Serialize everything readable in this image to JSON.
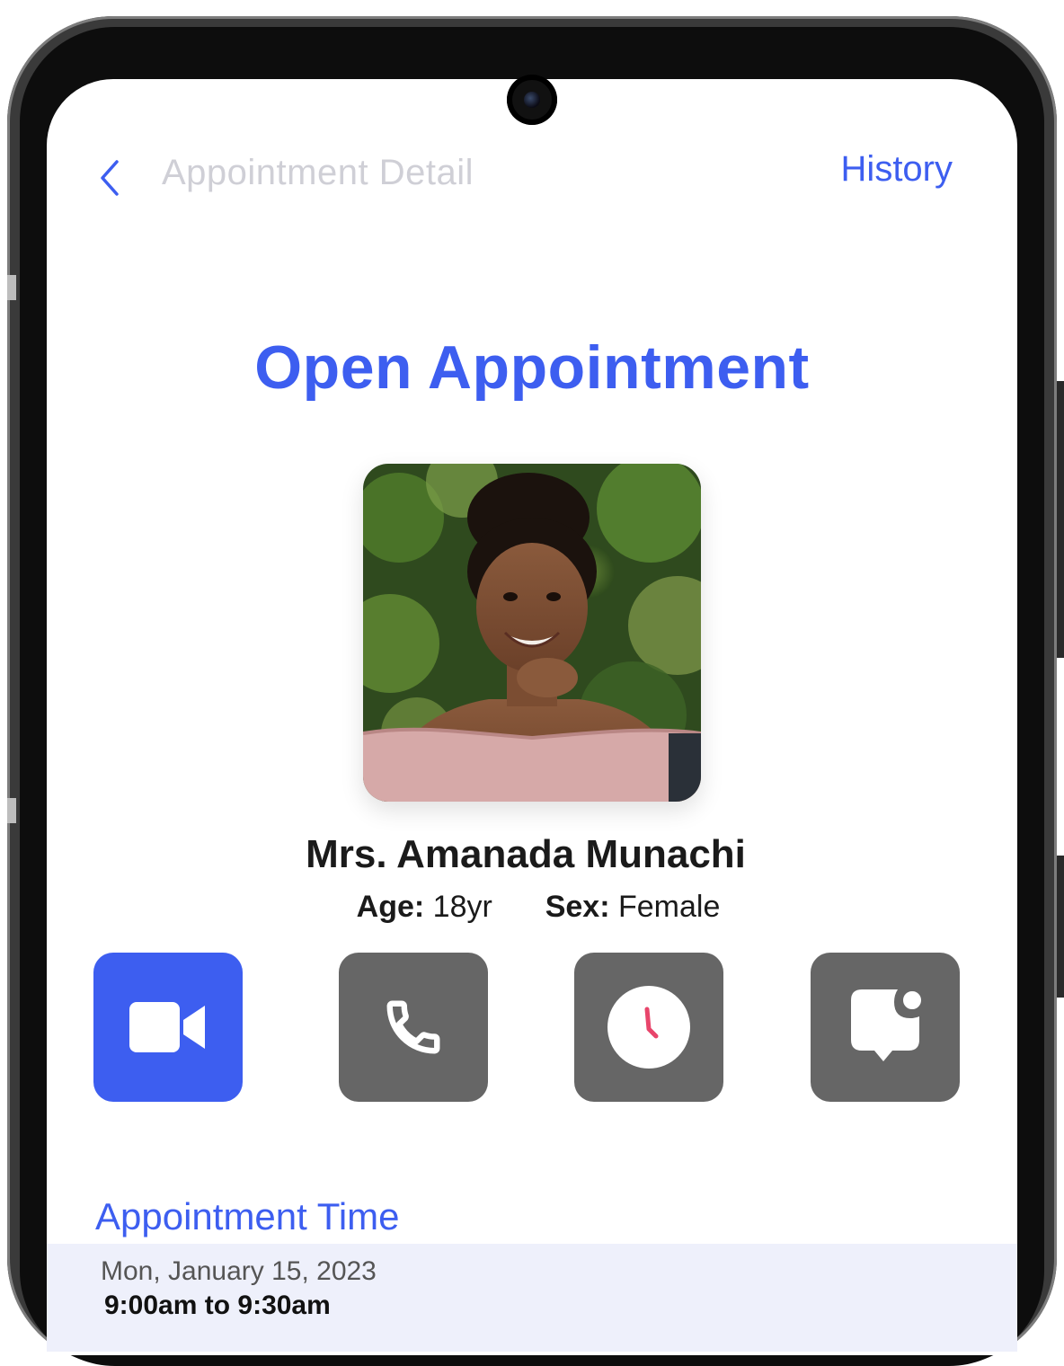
{
  "header": {
    "title": "Appointment Detail",
    "history_label": "History"
  },
  "page": {
    "title": "Open Appointment"
  },
  "patient": {
    "name": "Mrs. Amanada Munachi",
    "age_label": "Age:",
    "age_value": "18yr",
    "sex_label": "Sex:",
    "sex_value": "Female"
  },
  "actions": [
    {
      "name": "video-call",
      "icon": "video-camera-icon",
      "active": true
    },
    {
      "name": "voice-call",
      "icon": "phone-icon",
      "active": false
    },
    {
      "name": "schedule",
      "icon": "clock-icon",
      "active": false
    },
    {
      "name": "chat",
      "icon": "chat-bubble-icon",
      "active": false
    }
  ],
  "appointment_time": {
    "section_title": "Appointment Time",
    "date": "Mon, January 15, 2023",
    "time": "9:00am to 9:30am"
  },
  "colors": {
    "accent": "#3d5ef0",
    "button_gray": "#666666",
    "clock_hand": "#e8456b",
    "card_bg": "#eef0fb"
  }
}
